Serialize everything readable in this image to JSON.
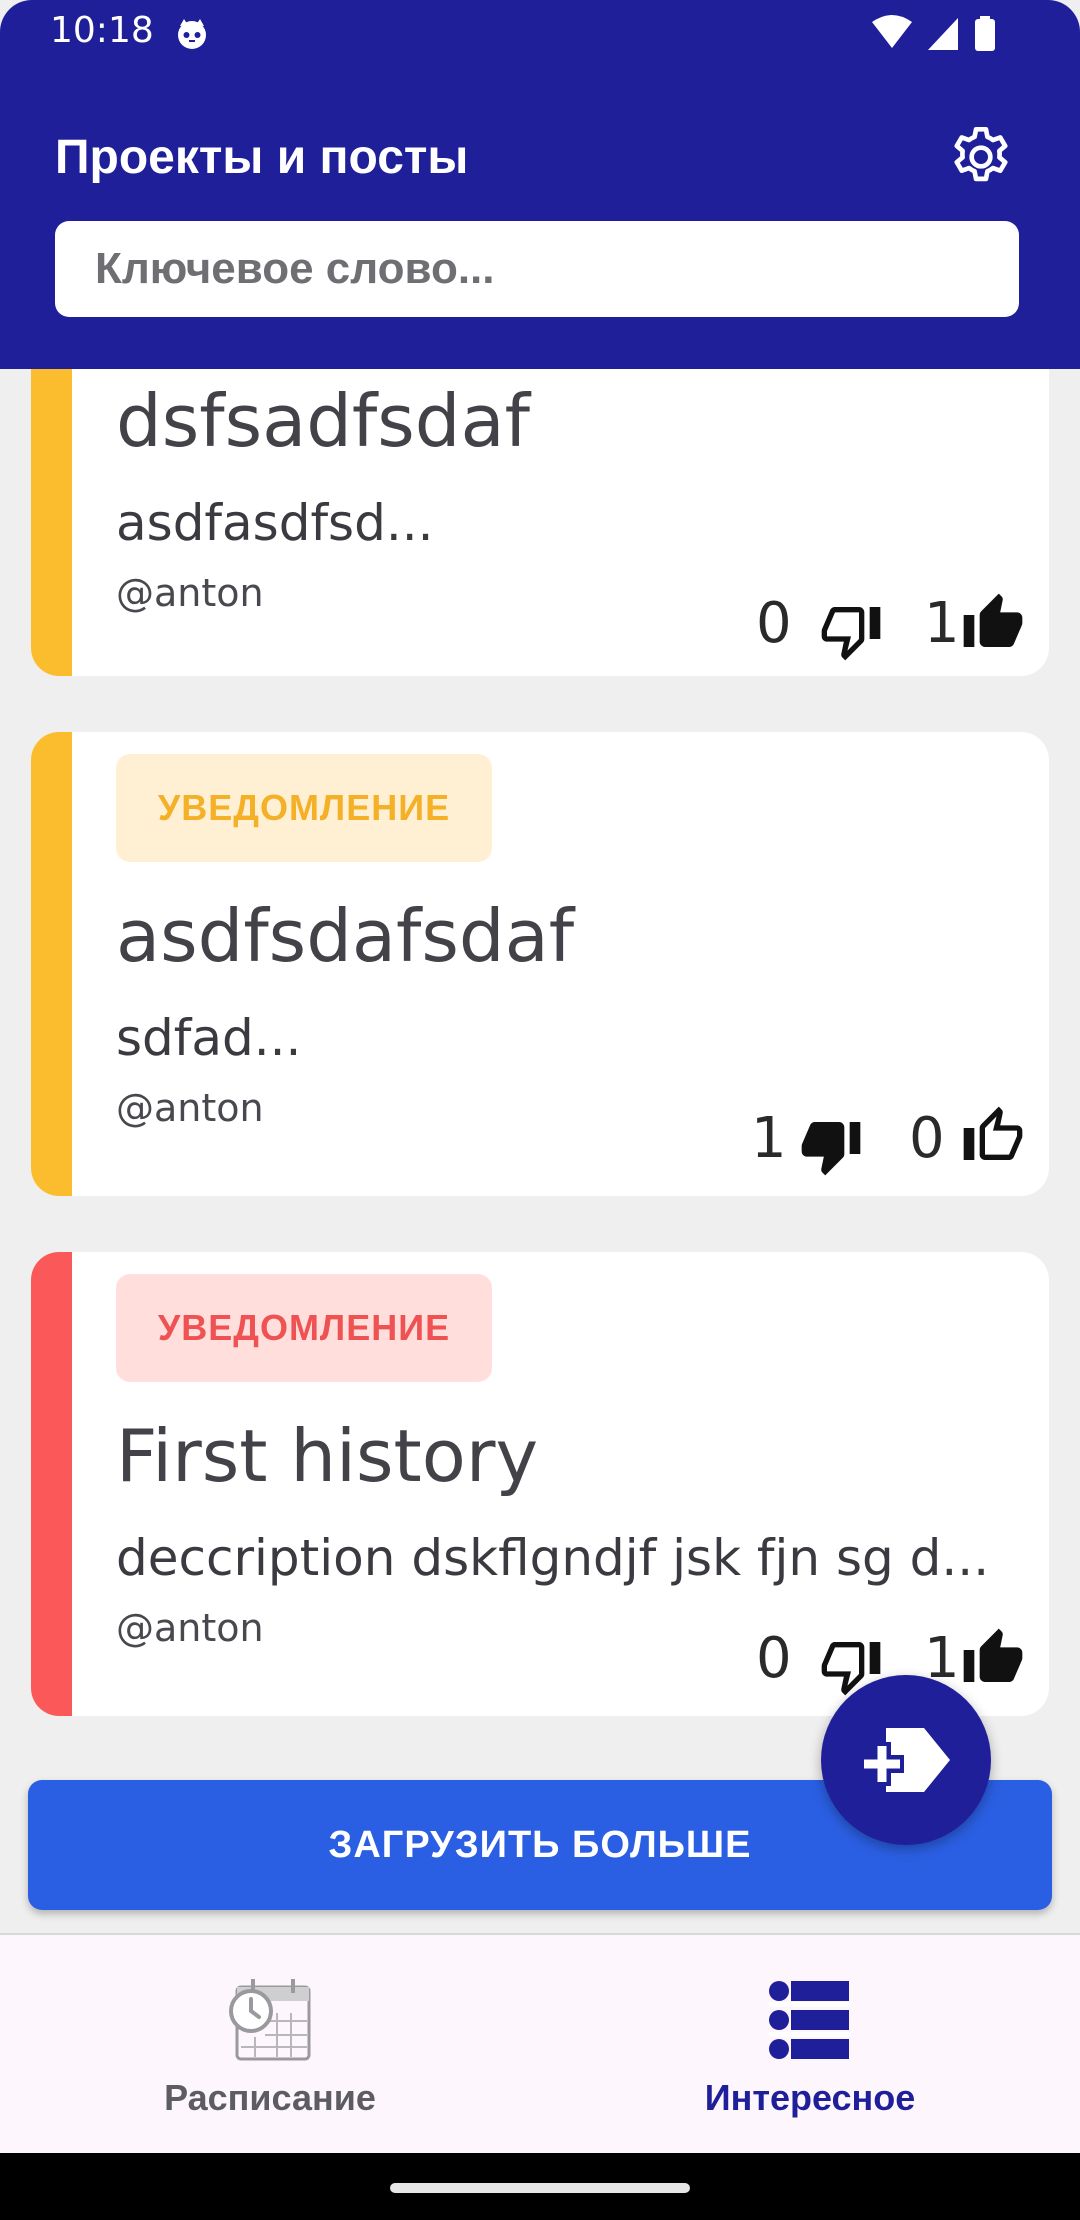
{
  "status_bar": {
    "time": "10:18"
  },
  "header": {
    "title": "Проекты и посты",
    "settings_icon": "gear-icon",
    "background_color": "#1f1f9a"
  },
  "search": {
    "placeholder": "Ключевое слово...",
    "value": ""
  },
  "cards": [
    {
      "accent_color": "#fbbd2e",
      "title": "dsfsadfsdaf",
      "description": "asdfasdfsd...",
      "author": "@anton",
      "dislikes": "0",
      "likes": "1",
      "dislike_icon": "thumbs-down-outline-icon",
      "like_icon": "thumbs-up-filled-icon"
    },
    {
      "accent_color": "#fbbd2e",
      "badge": "УВЕДОМЛЕНИЕ",
      "badge_bg": "#fff0d4",
      "badge_color": "#f4b027",
      "title": "asdfsdafsdaf",
      "description": "sdfad...",
      "author": "@anton",
      "dislikes": "1",
      "likes": "0",
      "dislike_icon": "thumbs-down-filled-icon",
      "like_icon": "thumbs-up-outline-icon"
    },
    {
      "accent_color": "#fb5959",
      "badge": "УВЕДОМЛЕНИЕ",
      "badge_bg": "#ffdedb",
      "badge_color": "#ef5252",
      "title": "First history",
      "description": "deccription dskflgndjf jsk fjn sg d...",
      "author": "@anton",
      "dislikes": "0",
      "likes": "1",
      "dislike_icon": "thumbs-down-outline-icon",
      "like_icon": "thumbs-up-filled-icon"
    }
  ],
  "load_more": {
    "label": "ЗАГРУЗИТЬ БОЛЬШЕ",
    "color": "#2b5fe3"
  },
  "fab": {
    "icon": "add-label-icon"
  },
  "bottom_nav": [
    {
      "label": "Расписание",
      "icon": "calendar-clock-icon",
      "active": false
    },
    {
      "label": "Интересное",
      "icon": "list-icon",
      "active": true
    }
  ]
}
